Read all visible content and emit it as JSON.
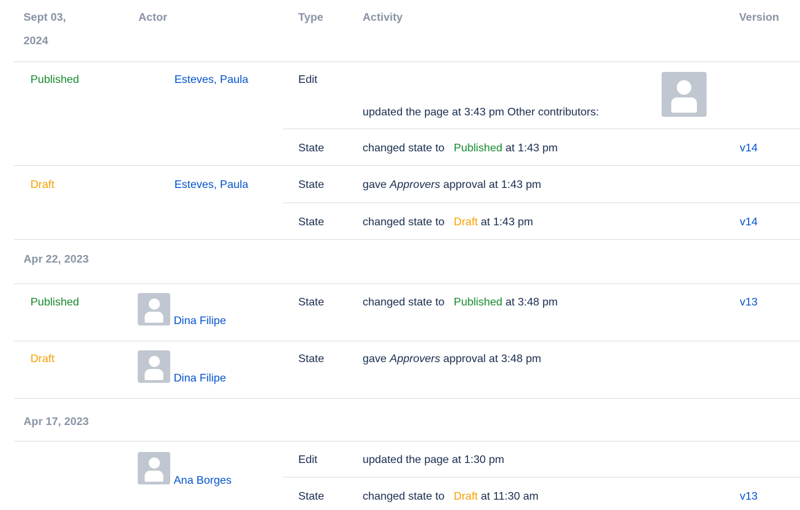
{
  "header": {
    "date_line1": "Sept 03,",
    "date_line2": "2024",
    "actor": "Actor",
    "type": "Type",
    "activity": "Activity",
    "version": "Version"
  },
  "g1": {
    "r1": {
      "state": "Published",
      "actor": "Esteves, Paula",
      "type": "Edit",
      "activity": "updated the page at 3:43 pm Other contributors:"
    },
    "r2": {
      "type": "State",
      "prefix": "changed state to",
      "state": "Published",
      "suffix": "at 1:43 pm",
      "version": "v14"
    },
    "r3": {
      "state": "Draft",
      "actor": "Esteves, Paula",
      "type": "State",
      "pre": "gave",
      "em": "Approvers",
      "post": "approval at 1:43 pm"
    },
    "r4": {
      "type": "State",
      "prefix": "changed state to",
      "state": "Draft",
      "suffix": "at 1:43 pm",
      "version": "v14"
    }
  },
  "g2": {
    "date": "Apr 22, 2023",
    "r1": {
      "state": "Published",
      "actor": "Dina Filipe",
      "type": "State",
      "prefix": "changed state to",
      "state2": "Published",
      "suffix": "at 3:48 pm",
      "version": "v13"
    },
    "r2": {
      "state": "Draft",
      "actor": "Dina Filipe",
      "type": "State",
      "pre": "gave",
      "em": "Approvers",
      "post": "approval at 3:48 pm"
    }
  },
  "g3": {
    "date": "Apr 17, 2023",
    "r1": {
      "actor": "Ana Borges",
      "type": "Edit",
      "activity": "updated the page at 1:30 pm"
    },
    "r2": {
      "type": "State",
      "prefix": "changed state to",
      "state": "Draft",
      "suffix": "at 11:30 am",
      "version": "v13"
    }
  },
  "colors": {
    "published": "#14892c",
    "draft": "#f5a000",
    "link": "#0052cc",
    "header": "#8993a4",
    "divider": "#dfe1e6"
  },
  "icons": {
    "avatar": "default-user-avatar-icon"
  }
}
